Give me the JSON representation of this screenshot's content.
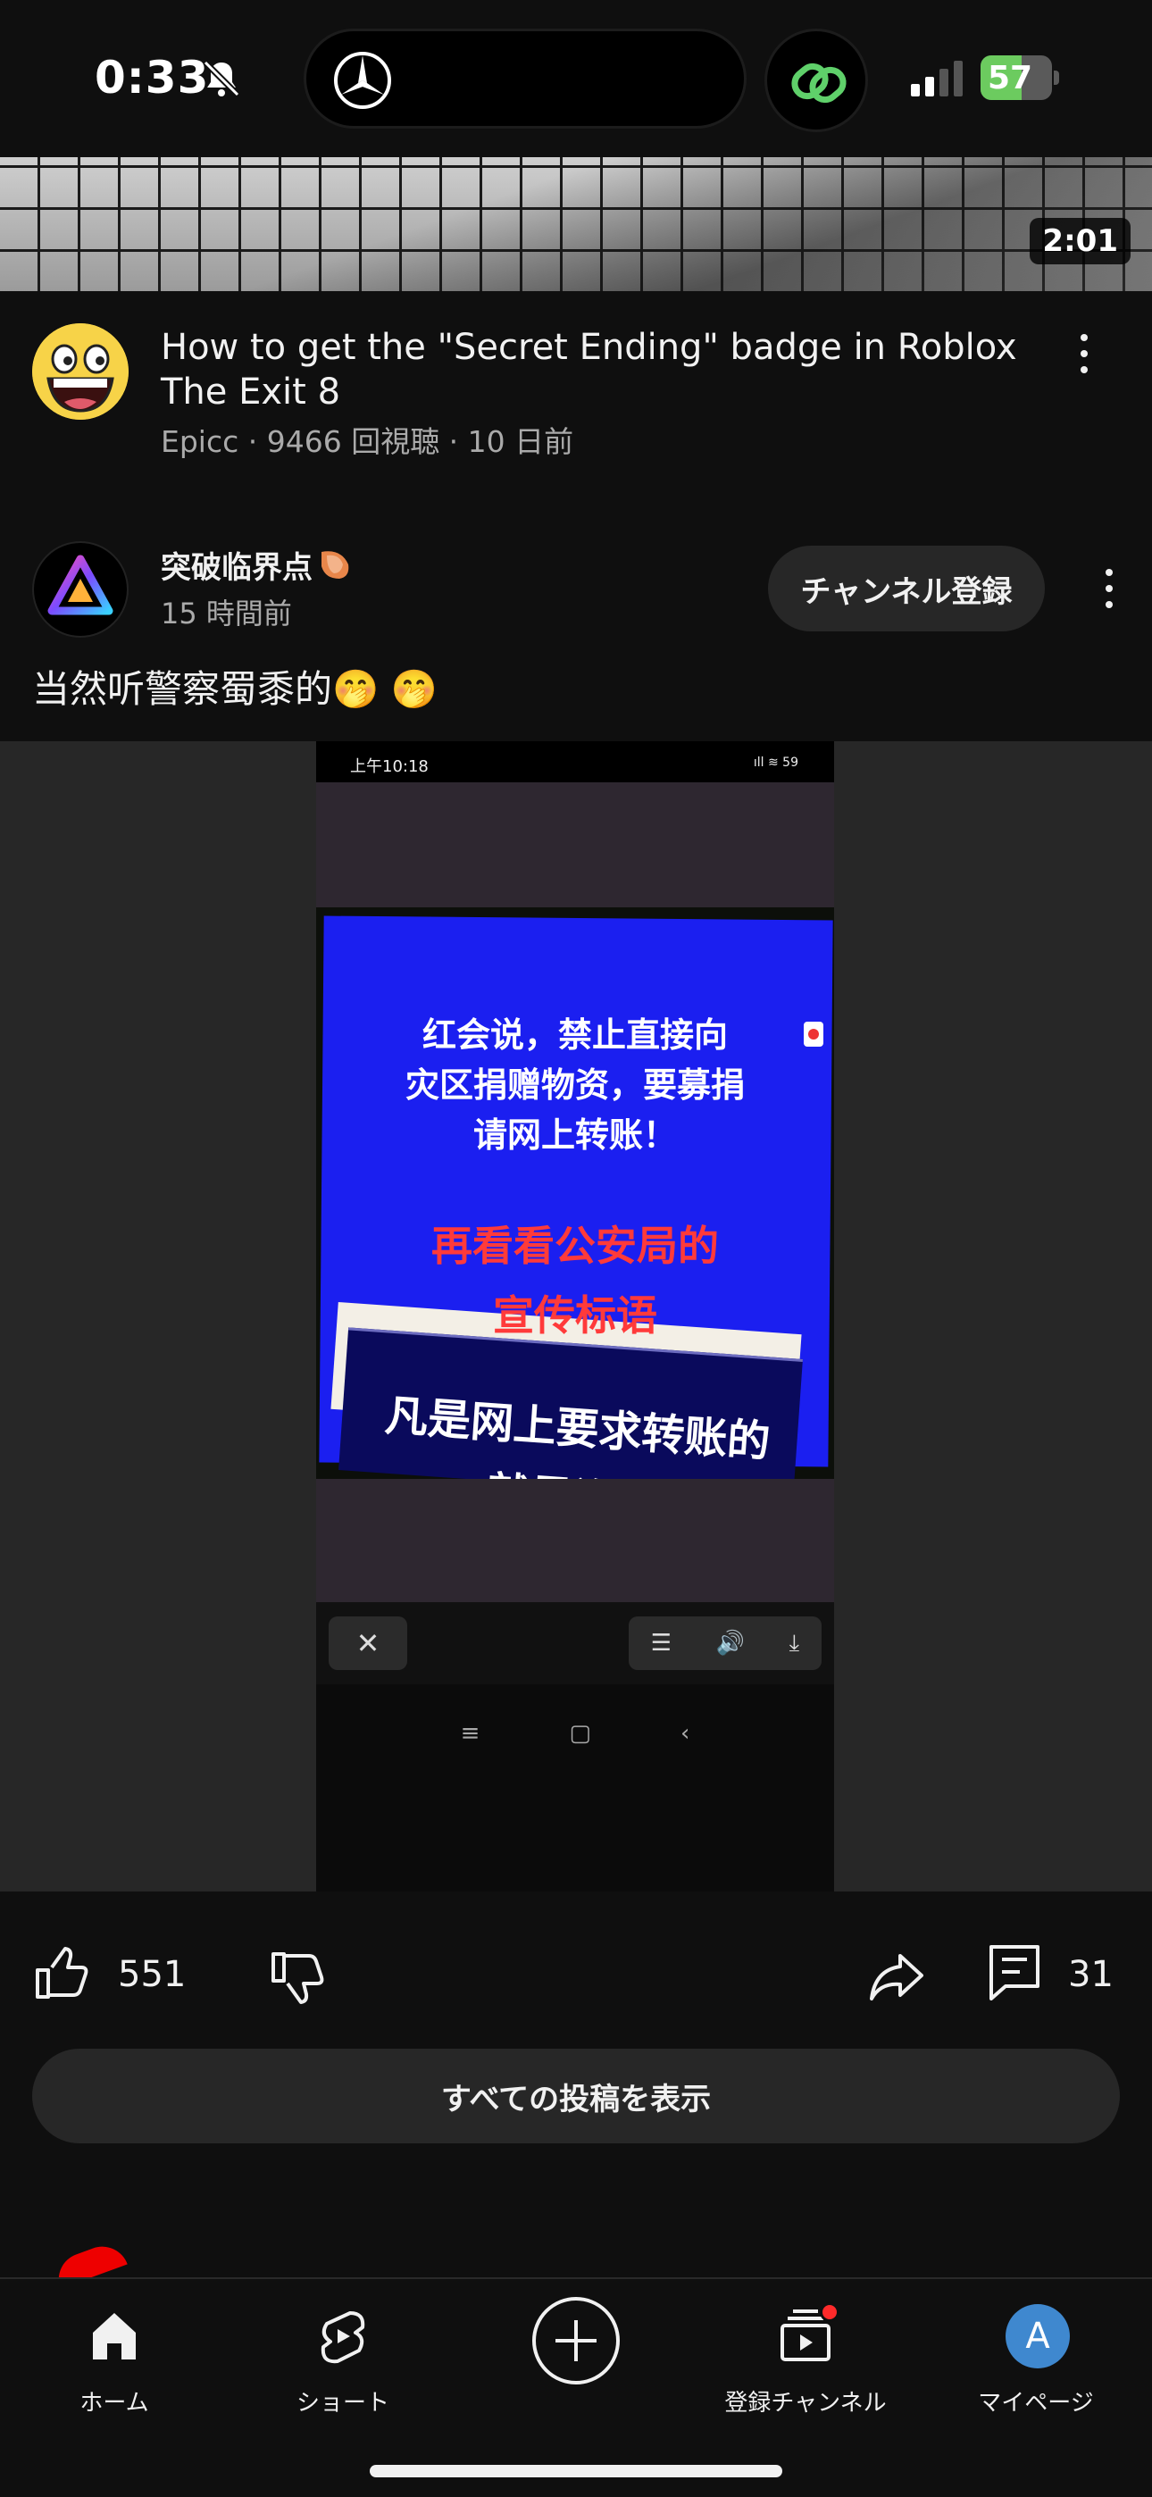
{
  "status_bar": {
    "time": "0:33",
    "battery": "57",
    "battery_level": 0.57
  },
  "video": {
    "duration": "2:01",
    "title": "How to get the \"Secret Ending\" badge in Roblox The Exit 8",
    "subtitle": "Epicc · 9466 回視聴 · 10 日前"
  },
  "post": {
    "channel_name": "突破临界点",
    "time": "15 時間前",
    "subscribe_label": "チャンネル登録",
    "text": "当然听警察蜀黍的🤭 🤭",
    "image": {
      "status_time": "上午10:18",
      "status_icons": "ıll ≋ 59",
      "sign_line1": "红会说，禁止直接向\n灾区捐赠物资，要募捐\n请网上转账！",
      "sign_line2": "再看看公安局的\n宣传标语",
      "sign_line3": "凡是网上要求转账的\n就是诈骗",
      "close_glyph": "✕",
      "tool_glyphs": [
        "☰",
        "🔊",
        "⤓"
      ],
      "nav_glyphs": [
        "≡",
        "▢",
        "‹"
      ]
    },
    "like_count": "551",
    "comment_count": "31",
    "all_posts_label": "すべての投稿を表示"
  },
  "bottom_nav": {
    "home": "ホーム",
    "shorts": "ショート",
    "subscriptions": "登録チャンネル",
    "you": "マイページ",
    "you_initial": "A"
  },
  "colors": {
    "background": "#0f0f0f",
    "chip": "#272727",
    "notification": "#ff2a2a",
    "avatar": "#3f88cf"
  }
}
